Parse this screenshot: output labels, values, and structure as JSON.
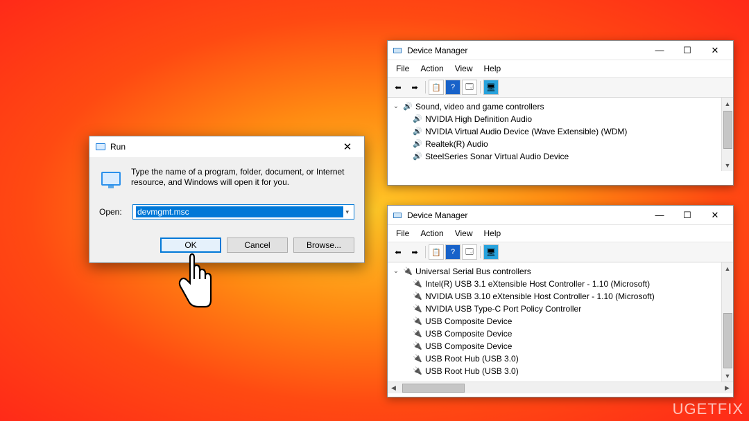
{
  "watermark": "UGETFIX",
  "run": {
    "title": "Run",
    "description": "Type the name of a program, folder, document, or Internet resource, and Windows will open it for you.",
    "open_label": "Open:",
    "input_value": "devmgmt.msc",
    "ok": "OK",
    "cancel": "Cancel",
    "browse": "Browse..."
  },
  "dm1": {
    "title": "Device Manager",
    "menu": [
      "File",
      "Action",
      "View",
      "Help"
    ],
    "category": "Sound, video and game controllers",
    "items": [
      "NVIDIA High Definition Audio",
      "NVIDIA Virtual Audio Device (Wave Extensible) (WDM)",
      "Realtek(R) Audio",
      "SteelSeries Sonar Virtual Audio Device"
    ]
  },
  "dm2": {
    "title": "Device Manager",
    "menu": [
      "File",
      "Action",
      "View",
      "Help"
    ],
    "category": "Universal Serial Bus controllers",
    "items": [
      "Intel(R) USB 3.1 eXtensible Host Controller - 1.10 (Microsoft)",
      "NVIDIA USB 3.10 eXtensible Host Controller - 1.10 (Microsoft)",
      "NVIDIA USB Type-C Port Policy Controller",
      "USB Composite Device",
      "USB Composite Device",
      "USB Composite Device",
      "USB Root Hub (USB 3.0)",
      "USB Root Hub (USB 3.0)"
    ]
  }
}
